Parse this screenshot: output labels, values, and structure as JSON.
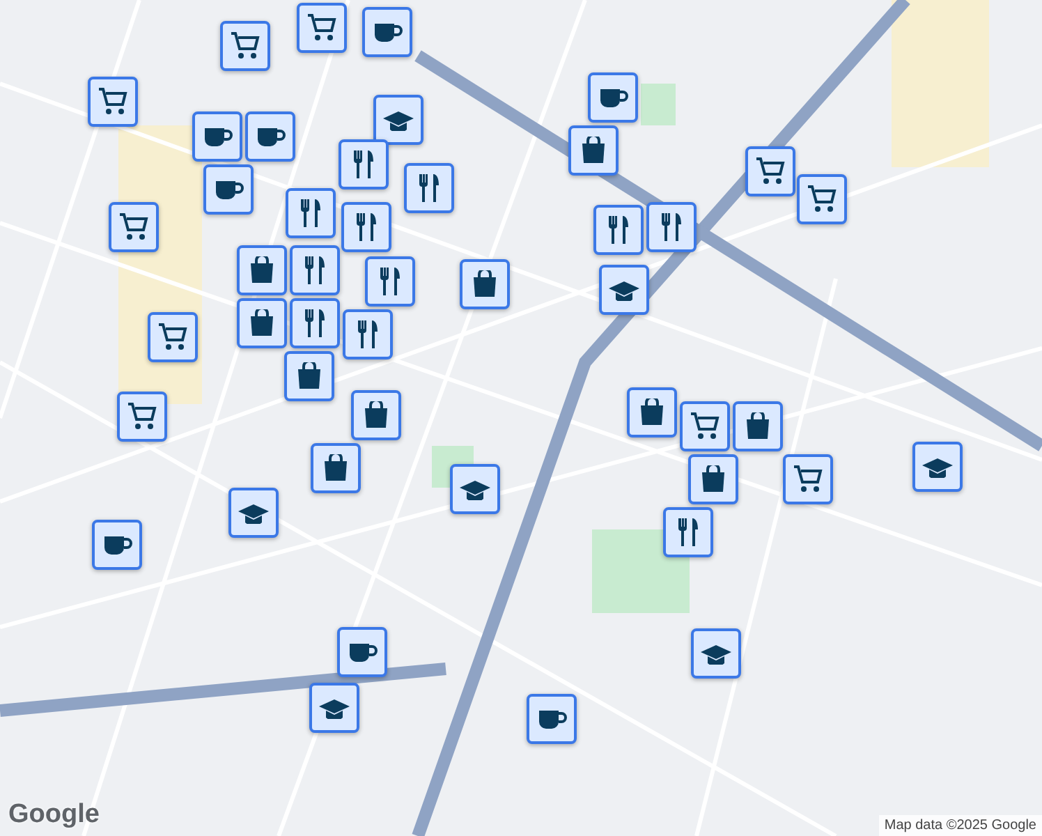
{
  "map": {
    "logo": "Google",
    "attribution": "Map data ©2025 Google"
  },
  "markers": [
    {
      "kind": "cart"
    },
    {
      "kind": "cart"
    },
    {
      "kind": "cup"
    },
    {
      "kind": "cup"
    },
    {
      "kind": "school"
    },
    {
      "kind": "cart"
    },
    {
      "kind": "cup"
    },
    {
      "kind": "cup"
    },
    {
      "kind": "cup"
    },
    {
      "kind": "restaurant"
    },
    {
      "kind": "restaurant"
    },
    {
      "kind": "bag"
    },
    {
      "kind": "cart"
    },
    {
      "kind": "cart"
    },
    {
      "kind": "restaurant"
    },
    {
      "kind": "restaurant"
    },
    {
      "kind": "cart"
    },
    {
      "kind": "bag"
    },
    {
      "kind": "restaurant"
    },
    {
      "kind": "restaurant"
    },
    {
      "kind": "bag"
    },
    {
      "kind": "restaurant"
    },
    {
      "kind": "restaurant"
    },
    {
      "kind": "school"
    },
    {
      "kind": "bag"
    },
    {
      "kind": "restaurant"
    },
    {
      "kind": "restaurant"
    },
    {
      "kind": "cart"
    },
    {
      "kind": "bag"
    },
    {
      "kind": "bag"
    },
    {
      "kind": "cart"
    },
    {
      "kind": "bag"
    },
    {
      "kind": "cart"
    },
    {
      "kind": "bag"
    },
    {
      "kind": "bag"
    },
    {
      "kind": "cart"
    },
    {
      "kind": "school"
    },
    {
      "kind": "bag"
    },
    {
      "kind": "school"
    },
    {
      "kind": "school"
    },
    {
      "kind": "cup"
    },
    {
      "kind": "restaurant"
    },
    {
      "kind": "school"
    },
    {
      "kind": "cup"
    },
    {
      "kind": "school"
    },
    {
      "kind": "cup"
    }
  ]
}
